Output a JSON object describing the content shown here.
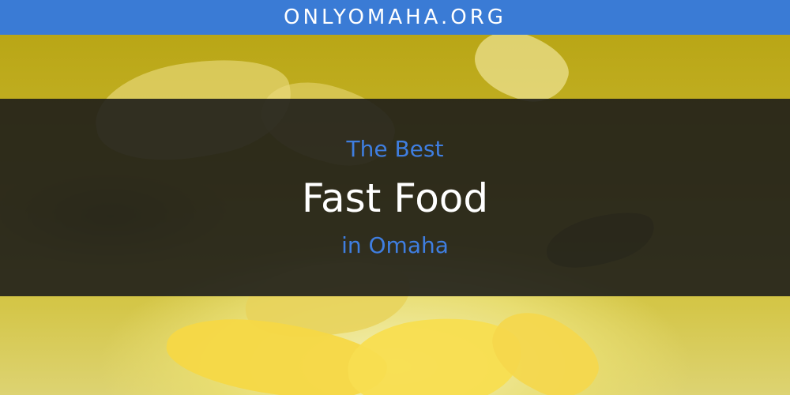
{
  "site": {
    "domain": "ONLYOMAHA.ORG"
  },
  "headline": {
    "pre": "The Best",
    "main": "Fast Food",
    "post": "in Omaha"
  },
  "colors": {
    "banner": "#3a7bd5",
    "accent_text": "#3f7ee0",
    "overlay": "#191919",
    "background_yellow": "#c9b21c"
  },
  "image": {
    "subject": "potato-chips-photo"
  }
}
